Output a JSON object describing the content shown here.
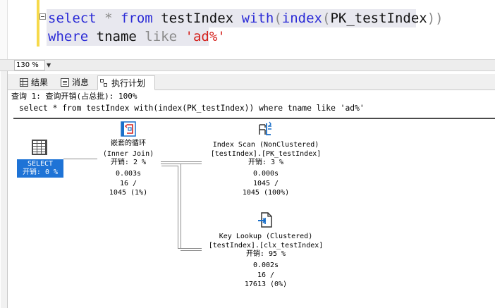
{
  "editor": {
    "line1": {
      "kw1": "select",
      "star": " * ",
      "kw2": "from",
      "table": " testIndex ",
      "kw3": "with",
      "paren1": "(",
      "kw4": "index",
      "paren2": "(",
      "idx": "PK_testIndex",
      "paren3": "))"
    },
    "line2": {
      "kw1": "where",
      "col": " tname ",
      "kw2": "like",
      "sp": " ",
      "str": "'ad%'"
    }
  },
  "zoom": {
    "value": "130 %"
  },
  "tabs": [
    {
      "label": "结果",
      "icon": "grid-icon"
    },
    {
      "label": "消息",
      "icon": "messages-icon"
    },
    {
      "label": "执行计划",
      "icon": "execution-plan-icon"
    }
  ],
  "plan": {
    "header": "查询 1: 查询开销(占总批): 100%",
    "query_text": "select * from testIndex with(index(PK_testIndex)) where tname like 'ad%'",
    "select_node": {
      "name": "SELECT",
      "cost": "开销: 0 %"
    },
    "nested_loop": {
      "name": "嵌套的循环",
      "subtitle": "(Inner Join)",
      "cost": "开销: 2 %",
      "time": "0.003s",
      "rows": "16 /",
      "est": "1045 (1%)"
    },
    "index_scan": {
      "name": "Index Scan (NonClustered)",
      "object": "[testIndex].[PK_testIndex]",
      "cost": "开销: 3 %",
      "time": "0.000s",
      "rows": "1045 /",
      "est": "1045 (100%)"
    },
    "key_lookup": {
      "name": "Key Lookup (Clustered)",
      "object": "[testIndex].[clx_testIndex]",
      "cost": "开销: 95 %",
      "time": "0.002s",
      "rows": "16 /",
      "est": "17613 (0%)"
    }
  },
  "colors": {
    "keyword": "#2b2bd6",
    "function": "#8a1ba8",
    "string": "#d4201b",
    "select_bg": "#1e73d6",
    "gutter": "#f6d94a"
  }
}
